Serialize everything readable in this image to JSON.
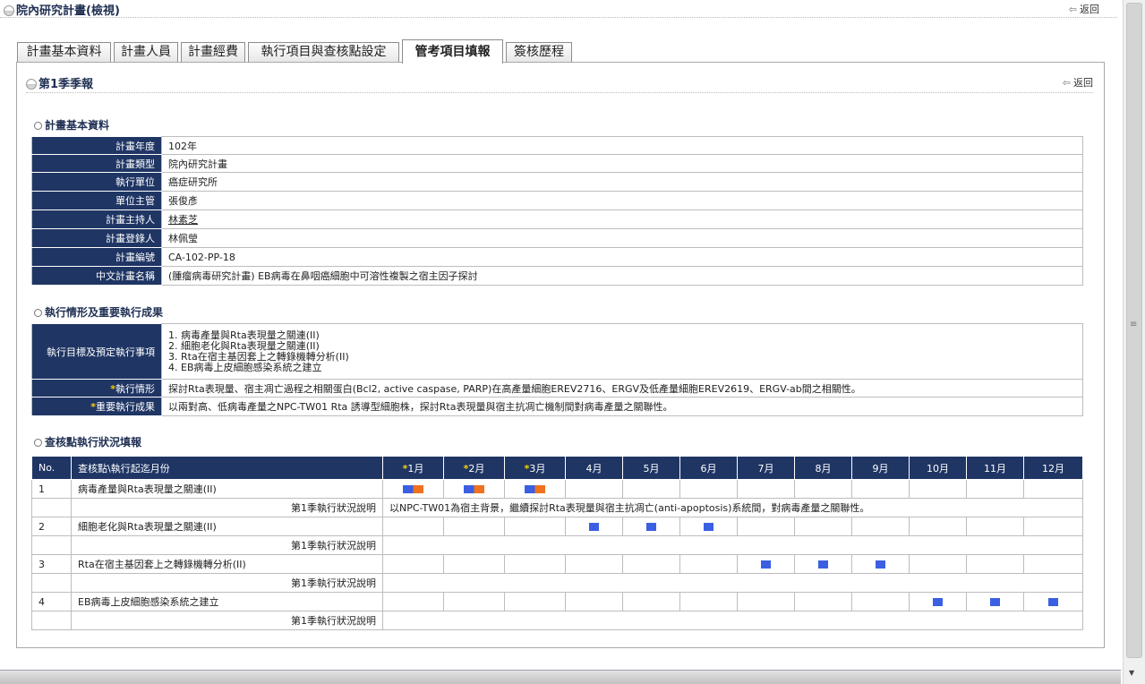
{
  "page": {
    "title": "院內研究計畫(檢視)",
    "back_label": "返回"
  },
  "tabs": [
    {
      "label": "計畫基本資料",
      "active": false
    },
    {
      "label": "計畫人員",
      "active": false
    },
    {
      "label": "計畫經費",
      "active": false
    },
    {
      "label": "執行項目與查核點設定",
      "active": false
    },
    {
      "label": "管考項目填報",
      "active": true
    },
    {
      "label": "簽核歷程",
      "active": false
    }
  ],
  "report": {
    "title": "第1季季報",
    "back_label": "返回"
  },
  "basic": {
    "title": "計畫基本資料",
    "rows": [
      {
        "label": "計畫年度",
        "value": "102年"
      },
      {
        "label": "計畫類型",
        "value": "院內研究計畫"
      },
      {
        "label": "執行單位",
        "value": "癌症研究所"
      },
      {
        "label": "單位主管",
        "value": "張俊彥"
      },
      {
        "label": "計畫主持人",
        "value": "林素芝"
      },
      {
        "label": "計畫登錄人",
        "value": "林佩瑩"
      },
      {
        "label": "計畫編號",
        "value": "CA-102-PP-18"
      },
      {
        "label": "中文計畫名稱",
        "value": "(腫瘤病毒研究計畫) EB病毒在鼻咽癌細胞中可溶性複製之宿主因子探討"
      }
    ]
  },
  "exec": {
    "title": "執行情形及重要執行成果",
    "goal_label": "執行目標及預定執行事項",
    "goals": [
      "1. 病毒產量與Rta表現量之關連(II)",
      "2. 細胞老化與Rta表現量之關連(II)",
      "3. Rta在宿主基因套上之轉錄機轉分析(II)",
      "4. EB病毒上皮細胞感染系統之建立"
    ],
    "status_label": "執行情形",
    "status_value": "探討Rta表現量、宿主凋亡過程之相關蛋白(Bcl2, active caspase, PARP)在高產量細胞EREV2716、ERGV及低產量細胞EREV2619、ERGV-ab間之相關性。",
    "result_label": "重要執行成果",
    "result_value": "以兩對高、低病毒產量之NPC-TW01 Rta 誘導型細胞株，探討Rta表現量與宿主抗凋亡機制間對病毒產量之關聯性。",
    "star": "*"
  },
  "checkpoints": {
    "title": "查核點執行狀況填報",
    "col_no": "No.",
    "col_item": "查核點\\執行起迄月份",
    "months": [
      "1月",
      "2月",
      "3月",
      "4月",
      "5月",
      "6月",
      "7月",
      "8月",
      "9月",
      "10月",
      "11月",
      "12月"
    ],
    "starred_months": [
      1,
      2,
      3
    ],
    "desc_label": "第1季執行狀況說明",
    "items": [
      {
        "no": "1",
        "name": "病毒產量與Rta表現量之關連(II)",
        "planned": [
          1,
          2,
          3
        ],
        "reported": [
          1,
          2,
          3
        ],
        "desc": "以NPC-TW01為宿主背景，繼續探討Rta表現量與宿主抗凋亡(anti-apoptosis)系統間，對病毒產量之關聯性。"
      },
      {
        "no": "2",
        "name": "細胞老化與Rta表現量之關連(II)",
        "planned": [
          4,
          5,
          6
        ],
        "reported": [],
        "desc": ""
      },
      {
        "no": "3",
        "name": "Rta在宿主基因套上之轉錄機轉分析(II)",
        "planned": [
          7,
          8,
          9
        ],
        "reported": [],
        "desc": ""
      },
      {
        "no": "4",
        "name": "EB病毒上皮細胞感染系統之建立",
        "planned": [
          10,
          11,
          12
        ],
        "reported": [],
        "desc": ""
      }
    ]
  },
  "colors": {
    "header_bg": "#1f3564",
    "planned": "#3b5fe3",
    "reported": "#ee7220",
    "star": "#f2d100"
  }
}
